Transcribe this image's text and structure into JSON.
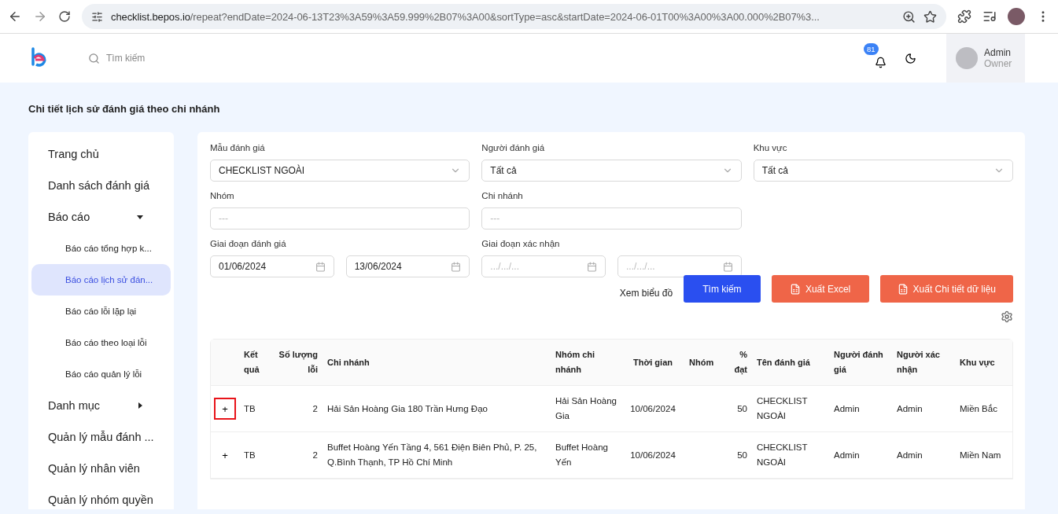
{
  "browser": {
    "url_host": "checklist.bepos.io",
    "url_rest": "/repeat?endDate=2024-06-13T23%3A59%3A59.999%2B07%3A00&sortType=asc&startDate=2024-06-01T00%3A00%3A00.000%2B07%3..."
  },
  "header": {
    "search_placeholder": "Tìm kiếm",
    "notification_count": "81",
    "user": {
      "name": "Admin",
      "role": "Owner"
    }
  },
  "page_title": "Chi tiết lịch sử đánh giá theo chi nhánh",
  "sidebar": {
    "items": [
      {
        "label": "Trang chủ",
        "kind": "link",
        "selected": false
      },
      {
        "label": "Danh sách đánh giá",
        "kind": "link",
        "selected": false
      },
      {
        "label": "Báo cáo",
        "kind": "group",
        "expanded": true,
        "selected": false,
        "children": [
          {
            "label": "Báo cáo tổng hợp k...",
            "selected": false
          },
          {
            "label": "Báo cáo lịch sử đán...",
            "selected": true
          },
          {
            "label": "Báo cáo lỗi lặp lại",
            "selected": false
          },
          {
            "label": "Báo cáo theo loại lỗi",
            "selected": false
          },
          {
            "label": "Báo cáo quản lý lỗi",
            "selected": false
          }
        ]
      },
      {
        "label": "Danh mục",
        "kind": "group",
        "expanded": false,
        "selected": false
      },
      {
        "label": "Quản lý mẫu đánh ...",
        "kind": "link",
        "selected": false
      },
      {
        "label": "Quản lý nhân viên",
        "kind": "link",
        "selected": false
      },
      {
        "label": "Quản lý nhóm quyền",
        "kind": "link",
        "selected": false
      }
    ]
  },
  "filters": [
    {
      "label": "Mẫu đánh giá",
      "kind": "select",
      "value": "CHECKLIST NGOÀI"
    },
    {
      "label": "Người đánh giá",
      "kind": "select",
      "value": "Tất cả"
    },
    {
      "label": "Khu vực",
      "kind": "select",
      "value": "Tất cả"
    },
    {
      "label": "Nhóm",
      "kind": "text",
      "placeholder": "---"
    },
    {
      "label": "Chi nhánh",
      "kind": "text",
      "placeholder": "---"
    },
    {
      "kind": "empty"
    },
    {
      "label": "Giai đoạn đánh giá",
      "kind": "daterange",
      "from": {
        "value": "01/06/2024"
      },
      "to": {
        "value": "13/06/2024"
      }
    },
    {
      "label": "Giai đoạn xác nhận",
      "kind": "daterange",
      "from": {
        "placeholder": ".../.../..."
      },
      "to": {
        "placeholder": ".../.../..."
      }
    }
  ],
  "actions": {
    "chart_link": "Xem biểu đồ",
    "buttons": [
      {
        "label": "Tìm kiếm",
        "kind": "primary"
      },
      {
        "label": "Xuất Excel",
        "kind": "export"
      },
      {
        "label": "Xuất Chi tiết dữ liệu",
        "kind": "export"
      }
    ]
  },
  "table": {
    "columns": [
      "Kết quả",
      "Số lượng lỗi",
      "Chi nhánh",
      "Nhóm chi nhánh",
      "Thời gian",
      "Nhóm",
      "% đạt",
      "Tên đánh giá",
      "Người đánh giá",
      "Người xác nhận",
      "Khu vực"
    ],
    "rows": [
      {
        "expand": "+",
        "highlighted": true,
        "cells": [
          "TB",
          "2",
          "Hải Sản Hoàng Gia 180 Trần Hưng Đạo",
          "Hải Sản Hoàng Gia",
          "10/06/2024",
          "",
          "50",
          "CHECKLIST NGOÀI",
          "Admin",
          "Admin",
          "Miền Bắc"
        ]
      },
      {
        "expand": "+",
        "highlighted": false,
        "cells": [
          "TB",
          "2",
          "Buffet Hoàng Yến Tầng 4, 561 Điện Biên Phủ, P. 25, Q.Bình Thạnh, TP Hồ Chí Minh",
          "Buffet Hoàng Yến",
          "10/06/2024",
          "",
          "50",
          "CHECKLIST NGOÀI",
          "Admin",
          "Admin",
          "Miền Nam"
        ]
      }
    ]
  }
}
